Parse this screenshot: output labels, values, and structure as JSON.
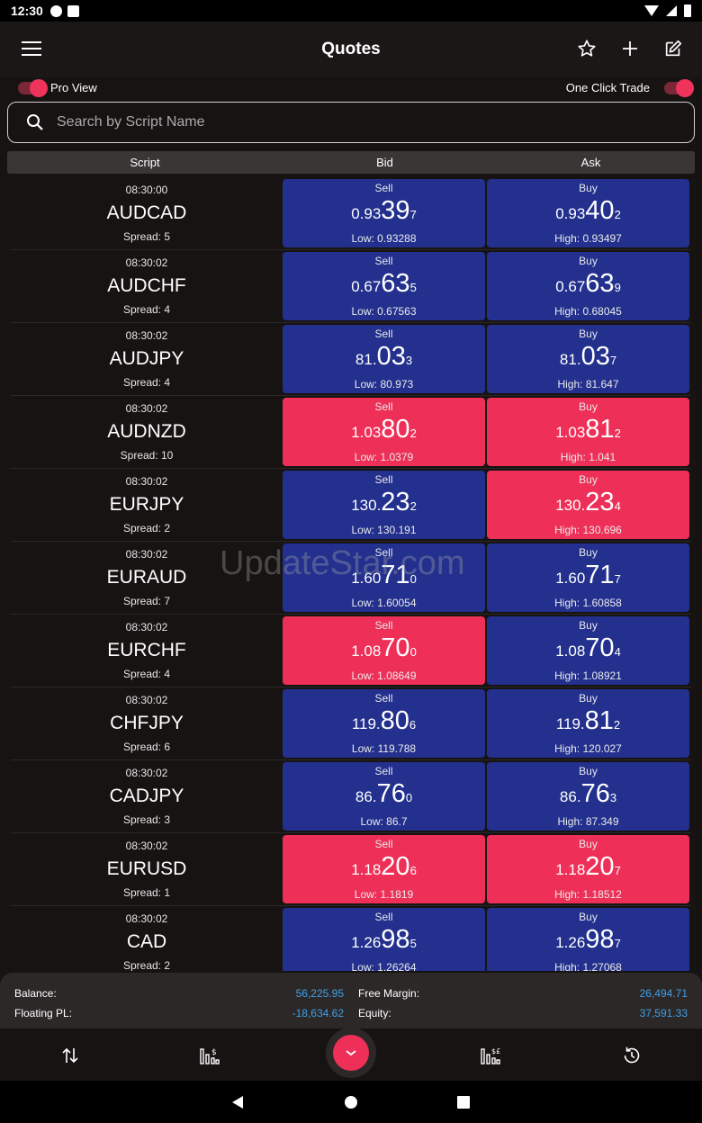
{
  "status_bar": {
    "time": "12:30"
  },
  "app_bar": {
    "title": "Quotes"
  },
  "toggles": {
    "pro_view": "Pro View",
    "one_click_trade": "One Click Trade"
  },
  "search": {
    "placeholder": "Search by Script Name"
  },
  "table_header": {
    "script": "Script",
    "bid": "Bid",
    "ask": "Ask"
  },
  "labels": {
    "sell": "Sell",
    "buy": "Buy"
  },
  "colors": {
    "buy_sell_blue": "#23308e",
    "buy_sell_red": "#ee3058",
    "accent_blue": "#3ea0e8"
  },
  "rows": [
    {
      "time": "08:30:00",
      "symbol": "AUDCAD",
      "spread": "Spread: 5",
      "bid": {
        "color": "blue",
        "pre": "0.93",
        "big": "39",
        "sup": "7",
        "limit": "Low: 0.93288"
      },
      "ask": {
        "color": "blue",
        "pre": "0.93",
        "big": "40",
        "sup": "2",
        "limit": "High: 0.93497"
      }
    },
    {
      "time": "08:30:02",
      "symbol": "AUDCHF",
      "spread": "Spread: 4",
      "bid": {
        "color": "blue",
        "pre": "0.67",
        "big": "63",
        "sup": "5",
        "limit": "Low: 0.67563"
      },
      "ask": {
        "color": "blue",
        "pre": "0.67",
        "big": "63",
        "sup": "9",
        "limit": "High: 0.68045"
      }
    },
    {
      "time": "08:30:02",
      "symbol": "AUDJPY",
      "spread": "Spread: 4",
      "bid": {
        "color": "blue",
        "pre": "81.",
        "big": "03",
        "sup": "3",
        "limit": "Low: 80.973"
      },
      "ask": {
        "color": "blue",
        "pre": "81.",
        "big": "03",
        "sup": "7",
        "limit": "High: 81.647"
      }
    },
    {
      "time": "08:30:02",
      "symbol": "AUDNZD",
      "spread": "Spread: 10",
      "bid": {
        "color": "red",
        "pre": "1.03",
        "big": "80",
        "sup": "2",
        "limit": "Low: 1.0379"
      },
      "ask": {
        "color": "red",
        "pre": "1.03",
        "big": "81",
        "sup": "2",
        "limit": "High: 1.041"
      }
    },
    {
      "time": "08:30:02",
      "symbol": "EURJPY",
      "spread": "Spread: 2",
      "bid": {
        "color": "blue",
        "pre": "130.",
        "big": "23",
        "sup": "2",
        "limit": "Low: 130.191"
      },
      "ask": {
        "color": "red",
        "pre": "130.",
        "big": "23",
        "sup": "4",
        "limit": "High: 130.696"
      }
    },
    {
      "time": "08:30:02",
      "symbol": "EURAUD",
      "spread": "Spread: 7",
      "bid": {
        "color": "blue",
        "pre": "1.60",
        "big": "71",
        "sup": "0",
        "limit": "Low: 1.60054"
      },
      "ask": {
        "color": "blue",
        "pre": "1.60",
        "big": "71",
        "sup": "7",
        "limit": "High: 1.60858"
      }
    },
    {
      "time": "08:30:02",
      "symbol": "EURCHF",
      "spread": "Spread: 4",
      "bid": {
        "color": "red",
        "pre": "1.08",
        "big": "70",
        "sup": "0",
        "limit": "Low: 1.08649"
      },
      "ask": {
        "color": "blue",
        "pre": "1.08",
        "big": "70",
        "sup": "4",
        "limit": "High: 1.08921"
      }
    },
    {
      "time": "08:30:02",
      "symbol": "CHFJPY",
      "spread": "Spread: 6",
      "bid": {
        "color": "blue",
        "pre": "119.",
        "big": "80",
        "sup": "6",
        "limit": "Low: 119.788"
      },
      "ask": {
        "color": "blue",
        "pre": "119.",
        "big": "81",
        "sup": "2",
        "limit": "High: 120.027"
      }
    },
    {
      "time": "08:30:02",
      "symbol": "CADJPY",
      "spread": "Spread: 3",
      "bid": {
        "color": "blue",
        "pre": "86.",
        "big": "76",
        "sup": "0",
        "limit": "Low: 86.7"
      },
      "ask": {
        "color": "blue",
        "pre": "86.",
        "big": "76",
        "sup": "3",
        "limit": "High: 87.349"
      }
    },
    {
      "time": "08:30:02",
      "symbol": "EURUSD",
      "spread": "Spread: 1",
      "bid": {
        "color": "red",
        "pre": "1.18",
        "big": "20",
        "sup": "6",
        "limit": "Low: 1.1819"
      },
      "ask": {
        "color": "red",
        "pre": "1.18",
        "big": "20",
        "sup": "7",
        "limit": "High: 1.18512"
      }
    },
    {
      "time": "08:30:02",
      "symbol": "CAD",
      "spread": "Spread: 2",
      "bid": {
        "color": "blue",
        "pre": "1.26",
        "big": "98",
        "sup": "5",
        "limit": "Low: 1.26264"
      },
      "ask": {
        "color": "blue",
        "pre": "1.26",
        "big": "98",
        "sup": "7",
        "limit": "High: 1.27068"
      }
    }
  ],
  "watermark": "UpdateStar.com",
  "summary": {
    "balance_label": "Balance:",
    "balance_value": "56,225.95",
    "floating_label": "Floating PL:",
    "floating_value": "-18,634.62",
    "free_margin_label": "Free Margin:",
    "free_margin_value": "26,494.71",
    "equity_label": "Equity:",
    "equity_value": "37,591.33"
  },
  "nav_icons": [
    "swap-vertical-icon",
    "chart-dollar-icon",
    "chevron-down-icon",
    "chart-exchange-icon",
    "history-icon"
  ]
}
